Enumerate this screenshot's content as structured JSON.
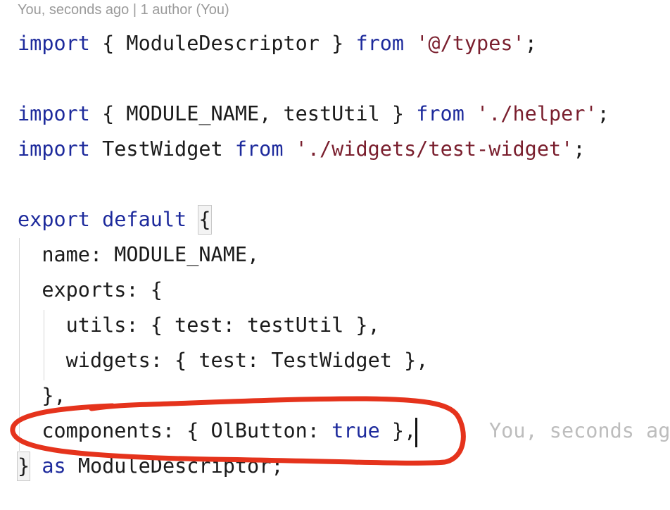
{
  "blame": {
    "header": "You, seconds ago | 1 author (You)",
    "inline_ghost": "You, seconds ag"
  },
  "code": {
    "l1_kw": "import",
    "l1_mid": " { ModuleDescriptor } ",
    "l1_from": "from",
    "l1_sp": " ",
    "l1_str": "'@/types'",
    "l1_end": ";",
    "l3_kw": "import",
    "l3_mid": " { MODULE_NAME, testUtil } ",
    "l3_from": "from",
    "l3_sp": " ",
    "l3_str": "'./helper'",
    "l3_end": ";",
    "l4_kw": "import",
    "l4_mid": " TestWidget ",
    "l4_from": "from",
    "l4_sp": " ",
    "l4_str": "'./widgets/test-widget'",
    "l4_end": ";",
    "l6_kw": "export default",
    "l6_sp": " ",
    "l6_brace": "{",
    "l7": "  name: MODULE_NAME,",
    "l8": "  exports: {",
    "l9": "    utils: { test: testUtil },",
    "l10": "    widgets: { test: TestWidget },",
    "l11": "  },",
    "l12_a": "  components: { OlButton: ",
    "l12_true": "true",
    "l12_b": " },",
    "l13_brace": "}",
    "l13_sp": " ",
    "l13_as": "as",
    "l13_rest": " ModuleDescriptor;"
  },
  "colors": {
    "keyword": "#1d2a9c",
    "string": "#7a1f2e",
    "annotation": "#e5331c"
  }
}
